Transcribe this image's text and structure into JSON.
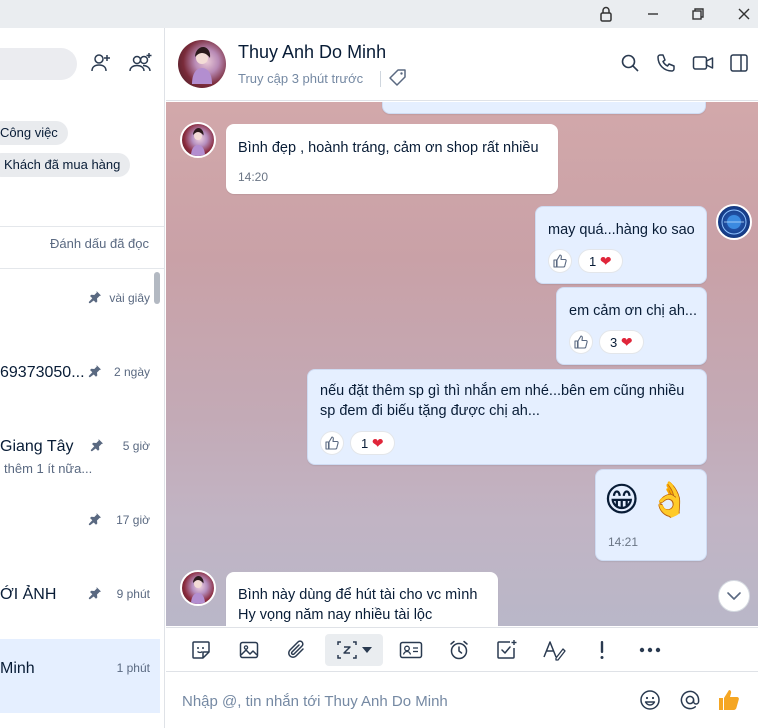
{
  "sidebar": {
    "tags": [
      "Công việc",
      "Khách đã mua hàng"
    ],
    "mark_read": "Đánh dấu đã đọc",
    "conversations": [
      {
        "name": "",
        "sub": "",
        "time": "vài giây",
        "pinned": true,
        "active": false
      },
      {
        "name": "69373050...",
        "sub": "",
        "time": "2 ngày",
        "pinned": true,
        "active": false
      },
      {
        "name": "Giang Tây",
        "sub": "thêm 1 ít nữa...",
        "time": "5 giờ",
        "pinned": true,
        "active": false
      },
      {
        "name": "",
        "sub": "",
        "time": "17 giờ",
        "pinned": true,
        "active": false
      },
      {
        "name": "ỚI ẢNH",
        "sub": "",
        "time": "9 phút",
        "pinned": true,
        "active": false
      },
      {
        "name": "Minh",
        "sub": "",
        "time": "1 phút",
        "pinned": false,
        "active": true
      }
    ]
  },
  "header": {
    "contact_name": "Thuy Anh Do Minh",
    "status": "Truy cập 3 phút trước"
  },
  "messages": [
    {
      "dir": "in",
      "lines": [
        "Bình đẹp , hoành tráng, cảm ơn shop rất nhiều"
      ],
      "time": "14:20"
    },
    {
      "dir": "out",
      "lines": [
        "may quá...hàng ko sao"
      ],
      "reaction_count": "1"
    },
    {
      "dir": "out",
      "lines": [
        "em cảm ơn chị ah..."
      ],
      "reaction_count": "3"
    },
    {
      "dir": "out",
      "lines": [
        "nếu đặt thêm sp gì thì nhắn em nhé...bên em cũng nhiều",
        "sp đem đi biếu tặng được chị ah..."
      ],
      "reaction_count": "1"
    },
    {
      "dir": "out",
      "lines": [
        "😁 👌"
      ],
      "time": "14:21"
    },
    {
      "dir": "in",
      "lines": [
        "Bình này dùng để hút tài cho vc mình",
        "Hy vọng năm nay nhiều tài lộc"
      ]
    }
  ],
  "composer": {
    "placeholder": "Nhập @, tin nhắn tới Thuy Anh Do Minh"
  },
  "colors": {
    "accent": "#0068ff",
    "out_bubble": "#e5efff",
    "heart": "#e0263a",
    "like": "#f5a623"
  }
}
